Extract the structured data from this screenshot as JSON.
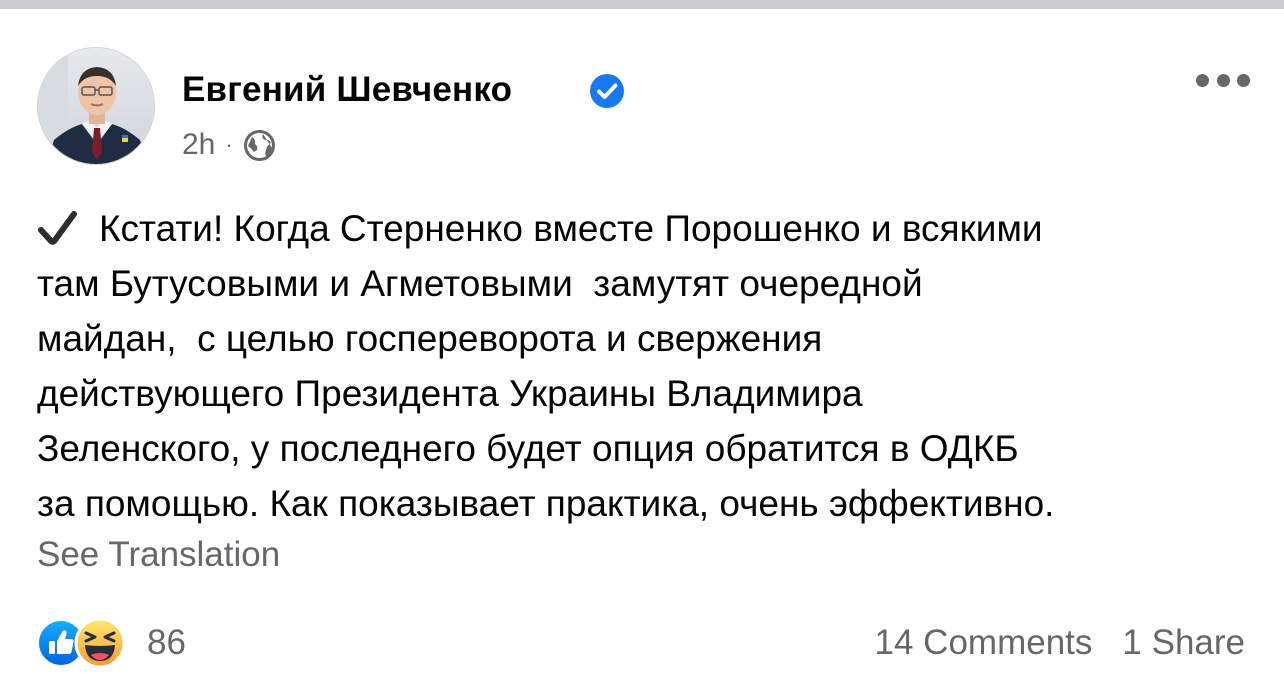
{
  "post": {
    "author": "Евгений Шевченко",
    "time": "2h",
    "separator": "·",
    "privacy_icon": "globe-icon",
    "verified_icon": "verified-badge-icon",
    "body_lines": [
      "Кстати! Когда Стерненко вместе Порошенко и всякими",
      "там Бутусовыми и Агметовыми  замутят очередной",
      "майдан,  с целью госпереворота и свержения",
      "действующего Президента Украины Владимира",
      "Зеленского, у последнего будет опция обратится в ОДКБ",
      "за помощью. Как показывает практика, очень эффективно."
    ],
    "see_translation": "See Translation"
  },
  "reactions": {
    "icons": [
      "like-icon",
      "haha-icon"
    ],
    "count": "86",
    "comments": "14 Comments",
    "shares": "1 Share"
  },
  "colors": {
    "text": "#050505",
    "secondary": "#65676b",
    "accent": "#1877f2"
  }
}
